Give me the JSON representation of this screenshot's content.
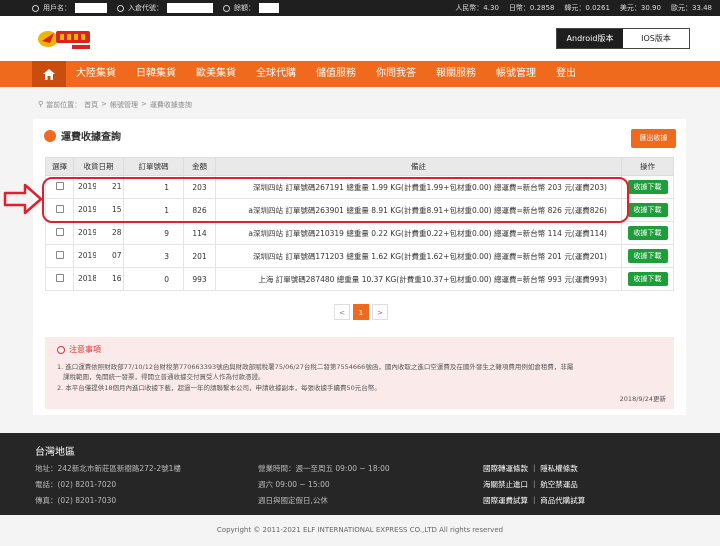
{
  "topbar": {
    "username_label": "用戶名：",
    "storage_label": "入倉代號：",
    "balance_label": "餘額：",
    "rates": [
      "人民幣：4.30",
      "日幣：0.2858",
      "韓元：0.0261",
      "美元：30.90",
      "歐元：33.48"
    ]
  },
  "header": {
    "android_label": "Android版本",
    "ios_label": "IOS版本"
  },
  "nav": {
    "items": [
      "大陸集貨",
      "日韓集貨",
      "歐美集貨",
      "全球代購",
      "儲值服務",
      "你問我答",
      "報關服務",
      "帳號管理",
      "登出"
    ]
  },
  "breadcrumb": {
    "prefix": "當前位置：",
    "items": [
      "首頁",
      "帳號管理",
      "運費收據查詢"
    ]
  },
  "panel": {
    "title": "運費收據查詢",
    "export_label": "匯出收據",
    "columns": [
      "選擇",
      "收貨日期",
      "訂單號碼",
      "金額",
      "備註",
      "操作"
    ],
    "download_label": "收據下載",
    "rows": [
      {
        "date_prefix": "2019",
        "date_suffix": "21",
        "order": "1",
        "amount": "203",
        "remark": "深圳四站 訂單號碼267191 總重量 1.99 KG(計費重1.99+包材重0.00) 總運費=新台幣 203 元(運費203)"
      },
      {
        "date_prefix": "2019",
        "date_suffix": "15",
        "order": "1",
        "amount": "826",
        "remark": "a深圳四站 訂單號碼263901 總重量 8.91 KG(計費重8.91+包材重0.00) 總運費=新台幣 826 元(運費826)"
      },
      {
        "date_prefix": "2019",
        "date_suffix": "28",
        "order": "9",
        "amount": "114",
        "remark": "a深圳四站 訂單號碼210319 總重量 0.22 KG(計費重0.22+包材重0.00) 總運費=新台幣 114 元(運費114)"
      },
      {
        "date_prefix": "2019",
        "date_suffix": "07",
        "order": "3",
        "amount": "201",
        "remark": "深圳四站 訂單號碼171203 總重量 1.62 KG(計費重1.62+包材重0.00) 總運費=新台幣 201 元(運費201)"
      },
      {
        "date_prefix": "2018",
        "date_suffix": "16",
        "order": "0",
        "amount": "993",
        "remark": "上海 訂單號碼287480 總重量 10.37 KG(計費重10.37+包材重0.00) 總運費=新台幣 993 元(運費993)"
      }
    ],
    "pager": {
      "prev": "<",
      "current": "1",
      "next": ">"
    }
  },
  "notice": {
    "title": "注意事項",
    "line1": "1. 進口運費依照財政部77/10/12台財稅第770663393號函與財政部賦稅署75/06/27台稅二發第7554666號函，國內收取之進口空運費及在國外發生之雜項費用例如倉租費，非屬",
    "line1b": "課稅範圍，免開統一發票，得開立普通收據交付買受人作為付款憑證。",
    "line2": "2. 本平台僅提供18個月內進口收據下載，超過一年的請聯繫本公司，申請收據副本，每張收據手續費50元台幣。",
    "date": "2018/9/24更新"
  },
  "footer": {
    "title": "台灣地區",
    "address": "地址：242新北市新莊區新樹路272-2號1樓",
    "phone": "電話：(02) 8201-7020",
    "fax": "傳真：(02) 8201-7030",
    "hours1": "營業時間：週一至周五 09:00 ~ 18:00",
    "hours2": "週六 09:00 ~ 15:00",
    "hours3": "週日與國定假日,公休",
    "links": [
      "國際轉運條款 ｜ 隱私權條款",
      "海關禁止進口 ｜ 航空禁運品",
      "國際運費試算 ｜ 商品代購試算"
    ],
    "copyright": "Copyright © 2011-2021 ELF INTERNATIONAL EXPRESS CO.,LTD All rights reserved"
  },
  "colors": {
    "brand_orange": "#f06a1d",
    "download_green": "#1e9e3a",
    "annotation_red": "#e0202f"
  }
}
